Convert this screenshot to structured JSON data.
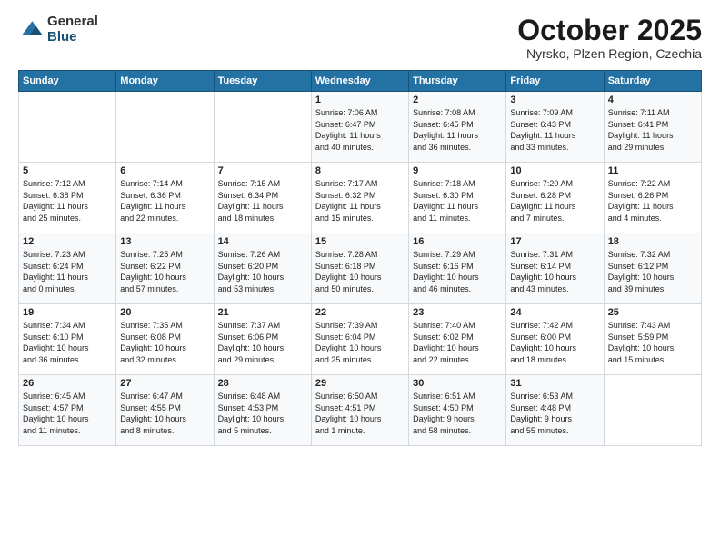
{
  "logo": {
    "general": "General",
    "blue": "Blue"
  },
  "header": {
    "month": "October 2025",
    "location": "Nyrsko, Plzen Region, Czechia"
  },
  "weekdays": [
    "Sunday",
    "Monday",
    "Tuesday",
    "Wednesday",
    "Thursday",
    "Friday",
    "Saturday"
  ],
  "weeks": [
    [
      {
        "day": "",
        "info": ""
      },
      {
        "day": "",
        "info": ""
      },
      {
        "day": "",
        "info": ""
      },
      {
        "day": "1",
        "info": "Sunrise: 7:06 AM\nSunset: 6:47 PM\nDaylight: 11 hours\nand 40 minutes."
      },
      {
        "day": "2",
        "info": "Sunrise: 7:08 AM\nSunset: 6:45 PM\nDaylight: 11 hours\nand 36 minutes."
      },
      {
        "day": "3",
        "info": "Sunrise: 7:09 AM\nSunset: 6:43 PM\nDaylight: 11 hours\nand 33 minutes."
      },
      {
        "day": "4",
        "info": "Sunrise: 7:11 AM\nSunset: 6:41 PM\nDaylight: 11 hours\nand 29 minutes."
      }
    ],
    [
      {
        "day": "5",
        "info": "Sunrise: 7:12 AM\nSunset: 6:38 PM\nDaylight: 11 hours\nand 25 minutes."
      },
      {
        "day": "6",
        "info": "Sunrise: 7:14 AM\nSunset: 6:36 PM\nDaylight: 11 hours\nand 22 minutes."
      },
      {
        "day": "7",
        "info": "Sunrise: 7:15 AM\nSunset: 6:34 PM\nDaylight: 11 hours\nand 18 minutes."
      },
      {
        "day": "8",
        "info": "Sunrise: 7:17 AM\nSunset: 6:32 PM\nDaylight: 11 hours\nand 15 minutes."
      },
      {
        "day": "9",
        "info": "Sunrise: 7:18 AM\nSunset: 6:30 PM\nDaylight: 11 hours\nand 11 minutes."
      },
      {
        "day": "10",
        "info": "Sunrise: 7:20 AM\nSunset: 6:28 PM\nDaylight: 11 hours\nand 7 minutes."
      },
      {
        "day": "11",
        "info": "Sunrise: 7:22 AM\nSunset: 6:26 PM\nDaylight: 11 hours\nand 4 minutes."
      }
    ],
    [
      {
        "day": "12",
        "info": "Sunrise: 7:23 AM\nSunset: 6:24 PM\nDaylight: 11 hours\nand 0 minutes."
      },
      {
        "day": "13",
        "info": "Sunrise: 7:25 AM\nSunset: 6:22 PM\nDaylight: 10 hours\nand 57 minutes."
      },
      {
        "day": "14",
        "info": "Sunrise: 7:26 AM\nSunset: 6:20 PM\nDaylight: 10 hours\nand 53 minutes."
      },
      {
        "day": "15",
        "info": "Sunrise: 7:28 AM\nSunset: 6:18 PM\nDaylight: 10 hours\nand 50 minutes."
      },
      {
        "day": "16",
        "info": "Sunrise: 7:29 AM\nSunset: 6:16 PM\nDaylight: 10 hours\nand 46 minutes."
      },
      {
        "day": "17",
        "info": "Sunrise: 7:31 AM\nSunset: 6:14 PM\nDaylight: 10 hours\nand 43 minutes."
      },
      {
        "day": "18",
        "info": "Sunrise: 7:32 AM\nSunset: 6:12 PM\nDaylight: 10 hours\nand 39 minutes."
      }
    ],
    [
      {
        "day": "19",
        "info": "Sunrise: 7:34 AM\nSunset: 6:10 PM\nDaylight: 10 hours\nand 36 minutes."
      },
      {
        "day": "20",
        "info": "Sunrise: 7:35 AM\nSunset: 6:08 PM\nDaylight: 10 hours\nand 32 minutes."
      },
      {
        "day": "21",
        "info": "Sunrise: 7:37 AM\nSunset: 6:06 PM\nDaylight: 10 hours\nand 29 minutes."
      },
      {
        "day": "22",
        "info": "Sunrise: 7:39 AM\nSunset: 6:04 PM\nDaylight: 10 hours\nand 25 minutes."
      },
      {
        "day": "23",
        "info": "Sunrise: 7:40 AM\nSunset: 6:02 PM\nDaylight: 10 hours\nand 22 minutes."
      },
      {
        "day": "24",
        "info": "Sunrise: 7:42 AM\nSunset: 6:00 PM\nDaylight: 10 hours\nand 18 minutes."
      },
      {
        "day": "25",
        "info": "Sunrise: 7:43 AM\nSunset: 5:59 PM\nDaylight: 10 hours\nand 15 minutes."
      }
    ],
    [
      {
        "day": "26",
        "info": "Sunrise: 6:45 AM\nSunset: 4:57 PM\nDaylight: 10 hours\nand 11 minutes."
      },
      {
        "day": "27",
        "info": "Sunrise: 6:47 AM\nSunset: 4:55 PM\nDaylight: 10 hours\nand 8 minutes."
      },
      {
        "day": "28",
        "info": "Sunrise: 6:48 AM\nSunset: 4:53 PM\nDaylight: 10 hours\nand 5 minutes."
      },
      {
        "day": "29",
        "info": "Sunrise: 6:50 AM\nSunset: 4:51 PM\nDaylight: 10 hours\nand 1 minute."
      },
      {
        "day": "30",
        "info": "Sunrise: 6:51 AM\nSunset: 4:50 PM\nDaylight: 9 hours\nand 58 minutes."
      },
      {
        "day": "31",
        "info": "Sunrise: 6:53 AM\nSunset: 4:48 PM\nDaylight: 9 hours\nand 55 minutes."
      },
      {
        "day": "",
        "info": ""
      }
    ]
  ]
}
